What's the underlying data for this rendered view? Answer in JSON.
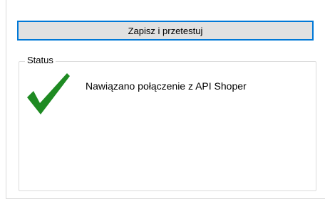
{
  "toolbar": {
    "save_test_label": "Zapisz i przetestuj"
  },
  "status": {
    "group_label": "Status",
    "message": "Nawiązano połączenie z API Shoper",
    "icon": "checkmark-icon",
    "icon_color": "#1e8a22"
  },
  "colors": {
    "button_focus": "#0078d7",
    "button_bg": "#e1e1e1"
  }
}
